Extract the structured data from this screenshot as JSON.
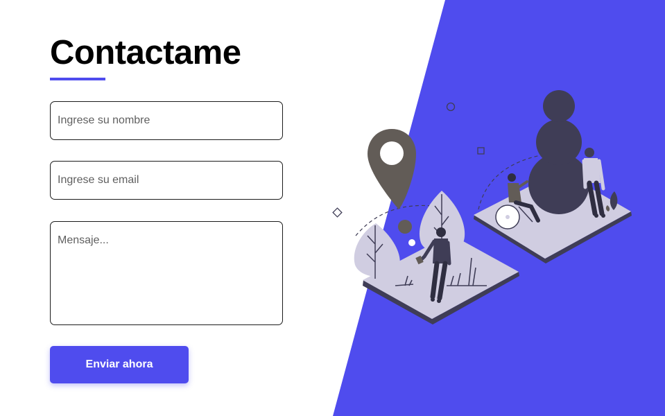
{
  "colors": {
    "accent": "#4f4cee",
    "illustration_dark": "#3f3d56",
    "illustration_light": "#d0cde1"
  },
  "contact": {
    "title": "Contactame",
    "name_placeholder": "Ingrese su nombre",
    "email_placeholder": "Ingrese su email",
    "message_placeholder": "Mensaje...",
    "submit_label": "Enviar ahora"
  },
  "illustration": {
    "icon": "location-people-illustration"
  }
}
